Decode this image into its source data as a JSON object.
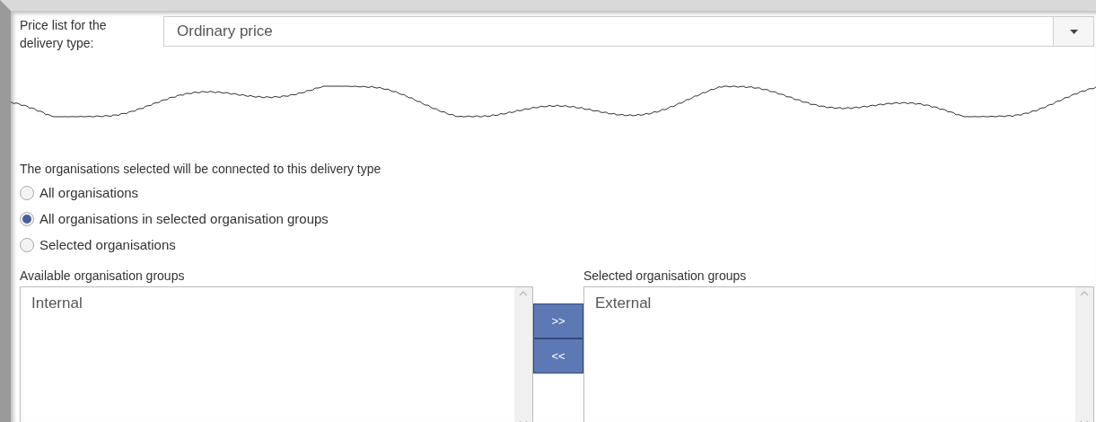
{
  "price_list": {
    "label": "Price list for the delivery type:",
    "value": "Ordinary price"
  },
  "organisations": {
    "caption": "The organisations selected will be connected to this delivery type",
    "options": [
      {
        "label": "All organisations",
        "selected": false
      },
      {
        "label": "All organisations in selected organisation groups",
        "selected": true
      },
      {
        "label": "Selected organisations",
        "selected": false
      }
    ]
  },
  "available_groups": {
    "label": "Available organisation groups",
    "items": [
      "Internal"
    ]
  },
  "transfer_buttons": [
    ">>",
    "<<"
  ],
  "selected_groups": {
    "label": "Selected organisation groups",
    "items": [
      "External"
    ]
  }
}
